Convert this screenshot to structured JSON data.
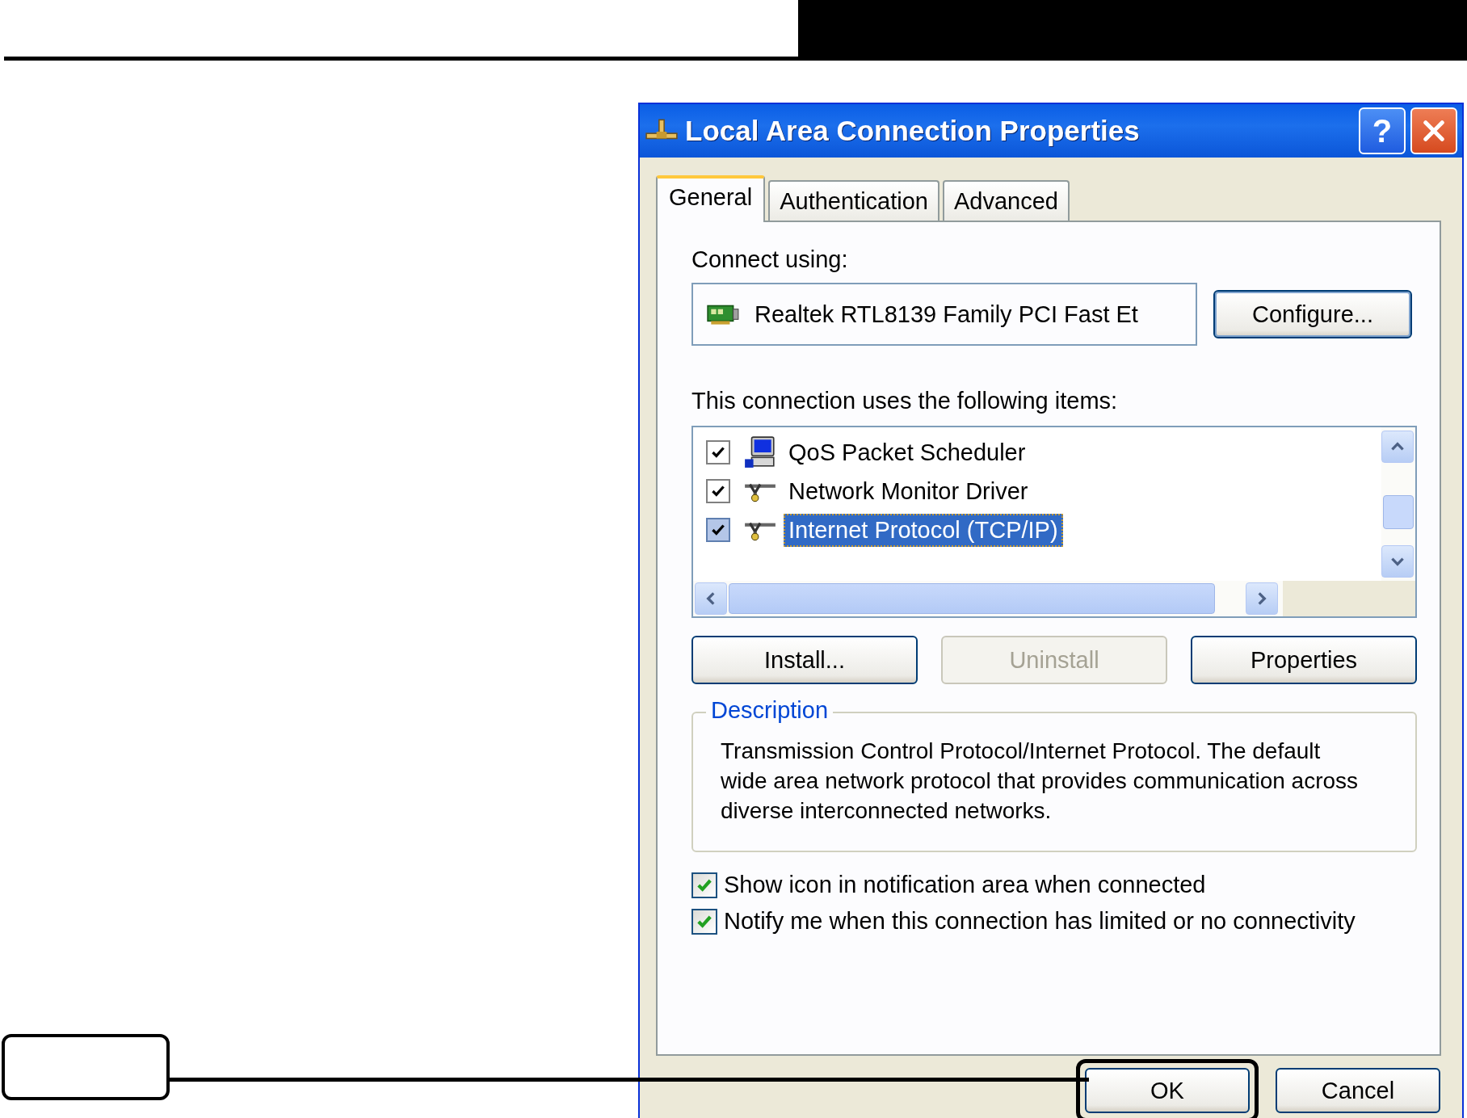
{
  "window": {
    "title": "Local Area Connection Properties",
    "help_button": "?"
  },
  "tabs": [
    {
      "label": "General",
      "selected": true
    },
    {
      "label": "Authentication",
      "selected": false
    },
    {
      "label": "Advanced",
      "selected": false
    }
  ],
  "connect_using": {
    "label": "Connect using:",
    "adapter": "Realtek RTL8139 Family PCI Fast Et",
    "configure_button": "Configure..."
  },
  "items": {
    "label": "This connection uses the following items:",
    "rows": [
      {
        "name": "QoS Packet Scheduler",
        "kind": "scheduler",
        "checked": true,
        "selected": false
      },
      {
        "name": "Network Monitor Driver",
        "kind": "protocol",
        "checked": true,
        "selected": false
      },
      {
        "name": "Internet Protocol (TCP/IP)",
        "kind": "protocol",
        "checked": true,
        "selected": true
      }
    ]
  },
  "item_buttons": [
    {
      "label": "Install...",
      "disabled": false
    },
    {
      "label": "Uninstall",
      "disabled": true
    },
    {
      "label": "Properties",
      "disabled": false
    }
  ],
  "description": {
    "legend": "Description",
    "text": "Transmission Control Protocol/Internet Protocol. The default wide area network protocol that provides communication across diverse interconnected networks."
  },
  "options": [
    {
      "label": "Show icon in notification area when connected",
      "checked": true
    },
    {
      "label": "Notify me when this connection has limited or no connectivity",
      "checked": true
    }
  ],
  "footer_buttons": [
    {
      "label": "OK",
      "highlighted": true
    },
    {
      "label": "Cancel",
      "highlighted": false
    }
  ]
}
